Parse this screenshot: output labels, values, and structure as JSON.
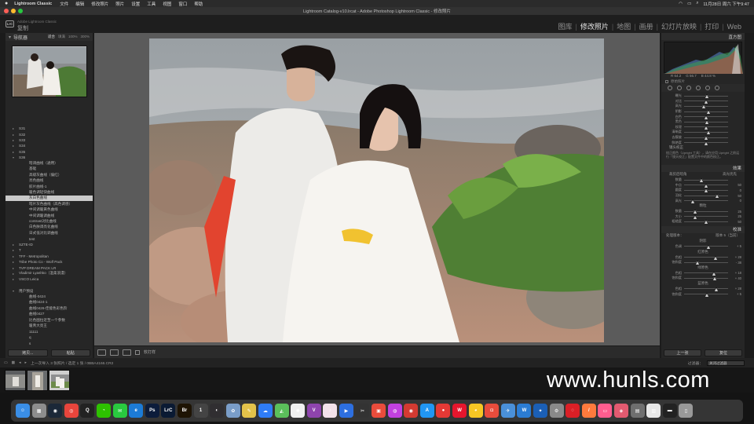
{
  "menubar": {
    "app": "Lightroom Classic",
    "items": [
      "文件",
      "编辑",
      "修改照片",
      "照片",
      "设置",
      "工具",
      "视图",
      "窗口",
      "帮助"
    ],
    "clock": "11月28日 周六 下午9:47"
  },
  "window": {
    "title": "Lightroom Catalog-v10.lrcat - Adobe Photoshop Lightroom Classic - 修改照片"
  },
  "identity": {
    "subtitle": "Adobe Lightroom Classic",
    "name": "复制"
  },
  "modules": [
    {
      "label": "图库",
      "active": false
    },
    {
      "label": "修改照片",
      "active": true
    },
    {
      "label": "地图",
      "active": false
    },
    {
      "label": "画册",
      "active": false
    },
    {
      "label": "幻灯片放映",
      "active": false
    },
    {
      "label": "打印",
      "active": false
    },
    {
      "label": "Web",
      "active": false
    }
  ],
  "left": {
    "navigator": {
      "title": "导航器",
      "options": [
        "适合",
        "填满",
        "100%",
        "300%"
      ]
    },
    "presets": [
      {
        "label": "S31",
        "indent": false,
        "tri": "▸"
      },
      {
        "label": "S32",
        "indent": false,
        "tri": "▸"
      },
      {
        "label": "S33",
        "indent": false,
        "tri": "▸"
      },
      {
        "label": "S34",
        "indent": false,
        "tri": "▸"
      },
      {
        "label": "S35",
        "indent": false,
        "tri": "▸"
      },
      {
        "label": "S36",
        "indent": false,
        "tri": "▾"
      },
      {
        "label": "暗调曲线（通用）",
        "indent": true,
        "tri": ""
      },
      {
        "label": "基础",
        "indent": true,
        "tri": ""
      },
      {
        "label": "高级灰曲线（偏红）",
        "indent": true,
        "tri": ""
      },
      {
        "label": "亮色曲线",
        "indent": true,
        "tri": ""
      },
      {
        "label": "胶片曲线-1",
        "indent": true,
        "tri": ""
      },
      {
        "label": "暖色调轻快曲线",
        "indent": true,
        "tri": ""
      },
      {
        "label": "灰白色曲线",
        "indent": true,
        "tri": "",
        "selected": true
      },
      {
        "label": "暗片灰色曲线（高色调感）",
        "indent": true,
        "tri": ""
      },
      {
        "label": "中间调暖黄色曲线",
        "indent": true,
        "tri": ""
      },
      {
        "label": "中间调暖调曲线",
        "indent": true,
        "tri": ""
      },
      {
        "label": "contrast对比曲线",
        "indent": true,
        "tri": ""
      },
      {
        "label": "白色肤调亮化曲线",
        "indent": true,
        "tri": ""
      },
      {
        "label": "日式低对比调曲线",
        "indent": true,
        "tri": ""
      },
      {
        "label": "test",
        "indent": true,
        "tri": ""
      },
      {
        "label": "SZTE-ID",
        "indent": false,
        "tri": "▸"
      },
      {
        "label": "T",
        "indent": false,
        "tri": "▸"
      },
      {
        "label": "TFF - Metropolitan",
        "indent": false,
        "tri": "▸"
      },
      {
        "label": "Tribe Photo Co - Wolf Pack",
        "indent": false,
        "tri": "▸"
      },
      {
        "label": "TVP DREAM PACK LR",
        "indent": false,
        "tri": "▸"
      },
      {
        "label": "Vladimir Lyashko（温柔浪漫）",
        "indent": false,
        "tri": "▸"
      },
      {
        "label": "VSCO Leica",
        "indent": false,
        "tri": "▸"
      },
      {
        "label": "",
        "indent": false,
        "tri": ""
      },
      {
        "label": "用户预设",
        "indent": false,
        "tri": "▾"
      },
      {
        "label": "曲线-0424",
        "indent": true,
        "tri": ""
      },
      {
        "label": "曲线0424-1",
        "indent": true,
        "tri": ""
      },
      {
        "label": "曲线0426-佳能色彩色阶",
        "indent": true,
        "tri": ""
      },
      {
        "label": "曲线0427",
        "indent": true,
        "tri": ""
      },
      {
        "label": "比色图拉近至一个参数",
        "indent": true,
        "tri": ""
      },
      {
        "label": "暖青大亮王",
        "indent": true,
        "tri": ""
      },
      {
        "label": "11111",
        "indent": true,
        "tri": ""
      },
      {
        "label": "q",
        "indent": true,
        "tri": ""
      },
      {
        "label": "s",
        "indent": true,
        "tri": ""
      }
    ],
    "buttons": {
      "copy": "拷贝...",
      "paste": "粘贴"
    }
  },
  "toolbar": {
    "label": "软打样"
  },
  "right": {
    "histogram": {
      "title": "直方图",
      "readout": [
        "R 64.2",
        "G 56.7",
        "B 44.8 %"
      ],
      "original": "原始照片"
    },
    "tone_sliders": [
      {
        "label": "曝光",
        "pos": 0.52,
        "value": ""
      },
      {
        "label": "对比",
        "pos": 0.5,
        "value": ""
      },
      {
        "label": "高光",
        "pos": 0.45,
        "value": ""
      },
      {
        "label": "阴影",
        "pos": 0.55,
        "value": ""
      },
      {
        "label": "白色",
        "pos": 0.5,
        "value": ""
      },
      {
        "label": "黑色",
        "pos": 0.52,
        "value": ""
      },
      {
        "label": "纹理",
        "pos": 0.5,
        "value": ""
      },
      {
        "label": "清晰度",
        "pos": 0.56,
        "value": ""
      },
      {
        "label": "去朦胧",
        "pos": 0.5,
        "value": ""
      },
      {
        "label": "鲜艳度",
        "pos": 0.5,
        "value": ""
      }
    ],
    "calibrate_note": "校正颜色（Upright 工具），请在应用 Upright 之前运行「镜头校正」配置文件中的颜色校正。",
    "calibrate_title": "镜头校正",
    "effects": {
      "title": "效果",
      "vignette_head": "裁剪后暗角",
      "vignette_style": "高光优先",
      "sliders": [
        {
          "label": "数量",
          "pos": 0.4,
          "value": ""
        },
        {
          "label": "中点",
          "pos": 0.5,
          "value": "50"
        },
        {
          "label": "圆度",
          "pos": 0.5,
          "value": "0"
        },
        {
          "label": "羽化",
          "pos": 0.75,
          "value": "50"
        },
        {
          "label": "高光",
          "pos": 0.2,
          "value": "0"
        }
      ],
      "grain_head": "颗粒",
      "grain_sliders": [
        {
          "label": "数量",
          "pos": 0.25,
          "value": "25"
        },
        {
          "label": "大小",
          "pos": 0.25,
          "value": "25"
        },
        {
          "label": "粗糙度",
          "pos": 0.5,
          "value": "50"
        }
      ]
    },
    "calibration": {
      "title": "校准",
      "process": "处理版本：",
      "version": "版本 5（当前）",
      "shadow_head": "阴影",
      "shadow": [
        {
          "label": "色调",
          "pos": 0.55,
          "value": "+ 5"
        }
      ],
      "red_head": "红原色",
      "red": [
        {
          "label": "色相",
          "pos": 0.72,
          "value": "+ 28"
        },
        {
          "label": "饱和度",
          "pos": 0.3,
          "value": "- 38"
        }
      ],
      "green_head": "绿原色",
      "green": [
        {
          "label": "色相",
          "pos": 0.68,
          "value": "+ 18"
        },
        {
          "label": "饱和度",
          "pos": 0.7,
          "value": "+ 40"
        }
      ],
      "blue_head": "蓝原色",
      "blue": [
        {
          "label": "色相",
          "pos": 0.74,
          "value": "+ 28"
        },
        {
          "label": "饱和度",
          "pos": 0.52,
          "value": "+ 5"
        }
      ]
    },
    "buttons": {
      "previous": "上一张",
      "reset": "复位"
    }
  },
  "filmbar": {
    "info": "上一次导入  3 张照片 / 选定 1 张 / 0BBA4166.CR2",
    "filter_label": "过滤器：",
    "filter_value": "关闭过滤器"
  },
  "watermark": "www.hunls.com",
  "dock": [
    {
      "name": "finder-icon",
      "color": "#3a8ee6",
      "glyph": "☺"
    },
    {
      "name": "launchpad-icon",
      "color": "#8d8d8d",
      "glyph": "▦"
    },
    {
      "name": "steam-icon",
      "color": "#1b2838",
      "glyph": "◉"
    },
    {
      "name": "chrome-icon",
      "color": "#e8453c",
      "glyph": "◎"
    },
    {
      "name": "qq-icon",
      "color": "#222222",
      "glyph": "Q"
    },
    {
      "name": "wechat-icon",
      "color": "#2dc100",
      "glyph": "◔"
    },
    {
      "name": "messages-icon",
      "color": "#29c93f",
      "glyph": "✉"
    },
    {
      "name": "edge-icon",
      "color": "#1c7bd6",
      "glyph": "e"
    },
    {
      "name": "photoshop-icon",
      "color": "#0c1c3b",
      "glyph": "Ps"
    },
    {
      "name": "lightroom-classic-icon",
      "color": "#0a1a33",
      "glyph": "LrC"
    },
    {
      "name": "bridge-icon",
      "color": "#1e1404",
      "glyph": "Br"
    },
    {
      "name": "capture-one-icon",
      "color": "#444444",
      "glyph": "1"
    },
    {
      "name": "obs-icon",
      "color": "#302e31",
      "glyph": "◐"
    },
    {
      "name": "pixelmator-icon",
      "color": "#7a9dc8",
      "glyph": "✿"
    },
    {
      "name": "notes-icon",
      "color": "#e3c24a",
      "glyph": "✎"
    },
    {
      "name": "baidu-netdisk-icon",
      "color": "#2f7cf6",
      "glyph": "☁"
    },
    {
      "name": "maps-icon",
      "color": "#5bbf5b",
      "glyph": "◭"
    },
    {
      "name": "photos-icon",
      "color": "#f0f0f0",
      "glyph": "✺"
    },
    {
      "name": "vivid-icon",
      "color": "#8e44ad",
      "glyph": "V"
    },
    {
      "name": "music-icon",
      "color": "#f3e2ea",
      "glyph": "♪"
    },
    {
      "name": "keynote-icon",
      "color": "#2d6fe0",
      "glyph": "▶"
    },
    {
      "name": "final-cut-icon",
      "color": "#333333",
      "glyph": "✂"
    },
    {
      "name": "video-icon",
      "color": "#e94c3c",
      "glyph": "▣"
    },
    {
      "name": "podcast-icon",
      "color": "#c241e0",
      "glyph": "◍"
    },
    {
      "name": "netease-music-icon",
      "color": "#d33a31",
      "glyph": "◉"
    },
    {
      "name": "app-store-icon",
      "color": "#2196f3",
      "glyph": "A"
    },
    {
      "name": "record-icon",
      "color": "#e53935",
      "glyph": "●"
    },
    {
      "name": "weibo-icon",
      "color": "#e6162d",
      "glyph": "W"
    },
    {
      "name": "meituan-icon",
      "color": "#f6c624",
      "glyph": "◕"
    },
    {
      "name": "screen-record-icon",
      "color": "#e74c3c",
      "glyph": "◘"
    },
    {
      "name": "spark-icon",
      "color": "#4a90d9",
      "glyph": "✈"
    },
    {
      "name": "word-icon",
      "color": "#2b7cd3",
      "glyph": "W"
    },
    {
      "name": "xcode-icon",
      "color": "#1b5fb5",
      "glyph": "✦"
    },
    {
      "name": "system-preferences-icon",
      "color": "#8a8a8a",
      "glyph": "⚙"
    },
    {
      "name": "creative-cloud-icon",
      "color": "#da1f26",
      "glyph": "◌"
    },
    {
      "name": "vectornator-icon",
      "color": "#ff7a3d",
      "glyph": "/"
    },
    {
      "name": "screenshot-icon",
      "color": "#ff5d8f",
      "glyph": "▭"
    },
    {
      "name": "safari-icon",
      "color": "#e25a70",
      "glyph": "◈"
    },
    {
      "name": "preview-icon",
      "color": "#6f6f6f",
      "glyph": "▤"
    },
    {
      "name": "folder-icon",
      "color": "#e8e8e8",
      "glyph": "▥"
    },
    {
      "name": "desktop-icon",
      "color": "#222222",
      "glyph": "▬"
    },
    {
      "name": "trash-icon",
      "color": "#999999",
      "glyph": "▯"
    }
  ]
}
